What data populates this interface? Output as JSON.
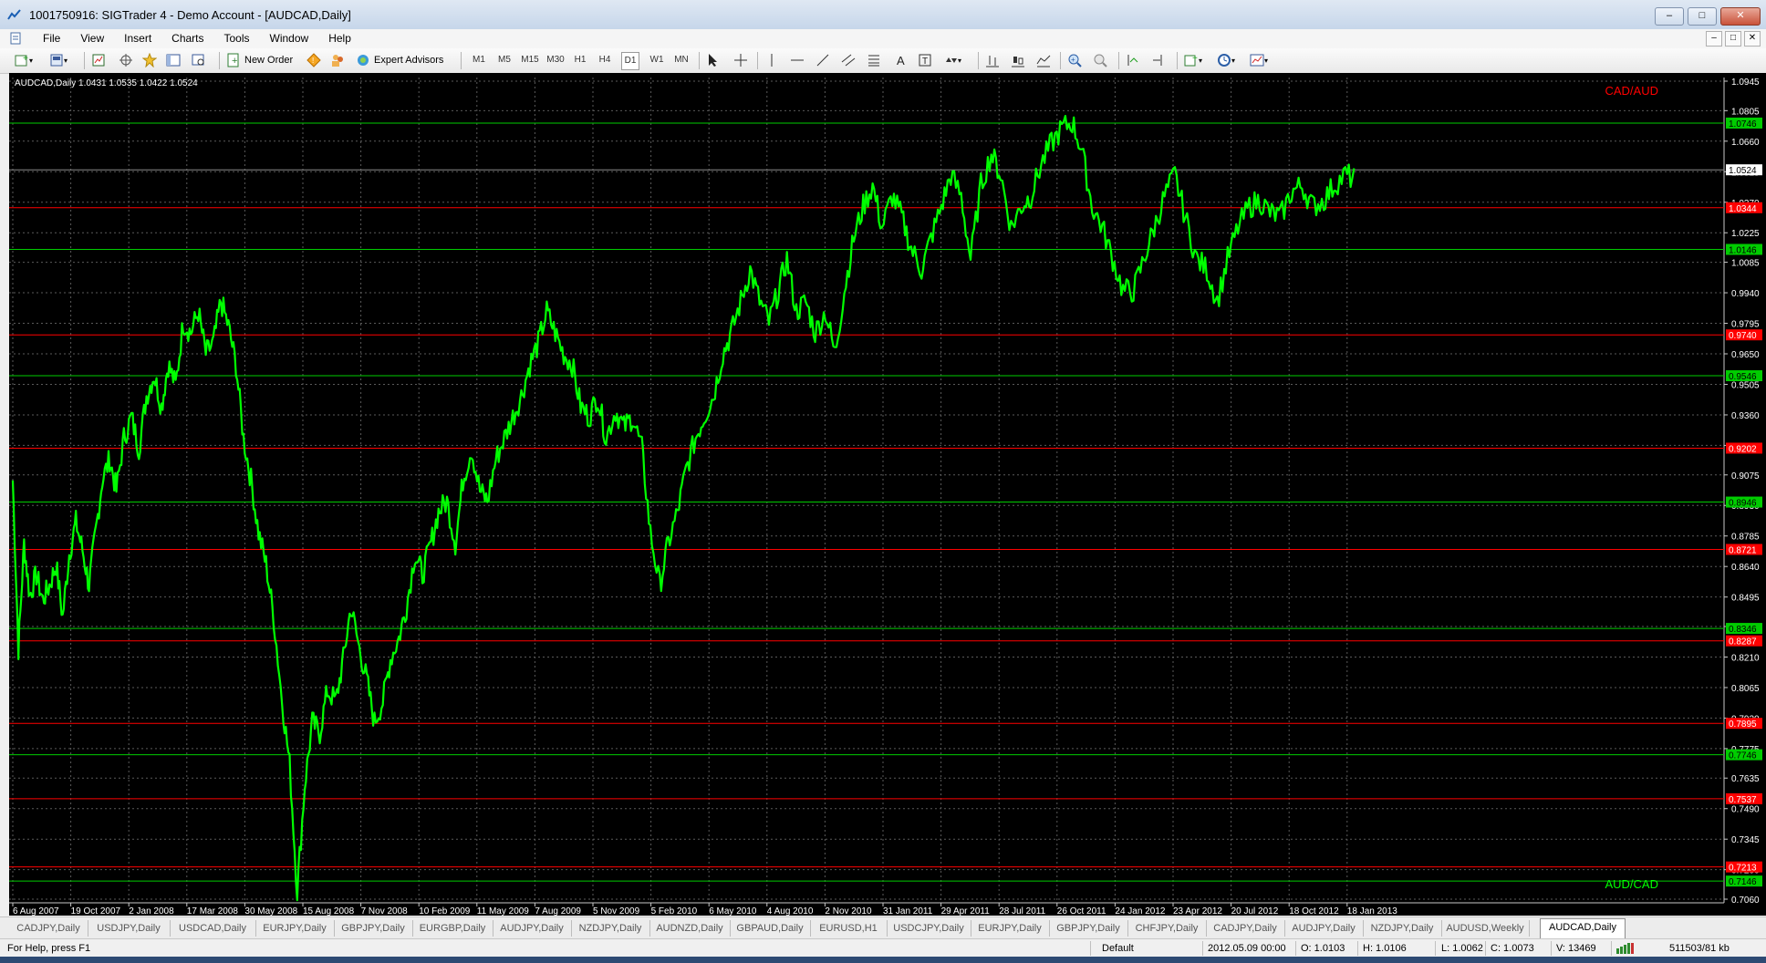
{
  "window": {
    "title": "1001750916: SIGTrader 4 - Demo Account - [AUDCAD,Daily]"
  },
  "menu": [
    "File",
    "View",
    "Insert",
    "Charts",
    "Tools",
    "Window",
    "Help"
  ],
  "toolbar": {
    "new_order": "New Order",
    "expert_advisors": "Expert Advisors",
    "timeframes": [
      "M1",
      "M5",
      "M15",
      "M30",
      "H1",
      "H4",
      "D1",
      "W1",
      "MN"
    ],
    "active_timeframe": "D1"
  },
  "chart": {
    "info": "AUDCAD,Daily  1.0431 1.0535 1.0422 1.0524",
    "label_top": "CAD/AUD",
    "label_bottom": "AUD/CAD",
    "colors": {
      "background": "#000000",
      "price": "#00ff00",
      "grid": "#5a5a5a",
      "support": "#00cc00",
      "resistance": "#ff0000",
      "current": "#8a8a8a",
      "label_red": "#ff0000",
      "label_green": "#00ff00"
    }
  },
  "chart_data": {
    "type": "line",
    "symbol": "AUDCAD",
    "timeframe": "Daily",
    "ylim": [
      0.706,
      1.0945
    ],
    "y_ticks": [
      "1.0945",
      "1.0805",
      "1.0660",
      "1.0515",
      "1.0370",
      "1.0225",
      "1.0085",
      "0.9940",
      "0.9795",
      "0.9650",
      "0.9505",
      "0.9360",
      "0.9215",
      "0.9075",
      "0.8930",
      "0.8785",
      "0.8640",
      "0.8495",
      "0.8355",
      "0.8210",
      "0.8065",
      "0.7920",
      "0.7775",
      "0.7635",
      "0.7490",
      "0.7345",
      "0.7200",
      "0.7060"
    ],
    "x_labels": [
      "6 Aug 2007",
      "19 Oct 2007",
      "2 Jan 2008",
      "17 Mar 2008",
      "30 May 2008",
      "15 Aug 2008",
      "7 Nov 2008",
      "10 Feb 2009",
      "11 May 2009",
      "7 Aug 2009",
      "5 Nov 2009",
      "5 Feb 2010",
      "6 May 2010",
      "4 Aug 2010",
      "2 Nov 2010",
      "31 Jan 2011",
      "29 Apr 2011",
      "28 Jul 2011",
      "26 Oct 2011",
      "24 Jan 2012",
      "23 Apr 2012",
      "20 Jul 2012",
      "18 Oct 2012",
      "18 Jan 2013"
    ],
    "current_price": 1.0524,
    "current_label": "1.0524",
    "levels": [
      {
        "price": 1.0746,
        "label": "1.0746",
        "kind": "support"
      },
      {
        "price": 1.0344,
        "label": "1.0344",
        "kind": "resistance"
      },
      {
        "price": 1.0146,
        "label": "1.0146",
        "kind": "support"
      },
      {
        "price": 0.974,
        "label": "0.9740",
        "kind": "resistance"
      },
      {
        "price": 0.9546,
        "label": "0.9546",
        "kind": "support"
      },
      {
        "price": 0.9202,
        "label": "0.9202",
        "kind": "resistance"
      },
      {
        "price": 0.8946,
        "label": "0.8946",
        "kind": "support"
      },
      {
        "price": 0.8721,
        "label": "0.8721",
        "kind": "resistance"
      },
      {
        "price": 0.8346,
        "label": "0.8346",
        "kind": "support"
      },
      {
        "price": 0.8287,
        "label": "0.8287",
        "kind": "resistance"
      },
      {
        "price": 0.7895,
        "label": "0.7895",
        "kind": "resistance"
      },
      {
        "price": 0.7746,
        "label": "0.7746",
        "kind": "support"
      },
      {
        "price": 0.7537,
        "label": "0.7537",
        "kind": "resistance"
      },
      {
        "price": 0.7213,
        "label": "0.7213",
        "kind": "resistance"
      },
      {
        "price": 0.7146,
        "label": "0.7146",
        "kind": "support"
      }
    ],
    "series_x": [
      0,
      0.6,
      1.2,
      1.8,
      2.5,
      3.2,
      3.9,
      4.6,
      5.3,
      6.0,
      6.7,
      7.4,
      8.1,
      8.8,
      9.5,
      10.3,
      11.0,
      11.8,
      12.6,
      13.4,
      14.2,
      15.0,
      15.8,
      16.5,
      17.3,
      18.1,
      18.9,
      19.7,
      20.5,
      21.3,
      22.1,
      22.9,
      23.7,
      24.5,
      25.3,
      26.1,
      26.9,
      27.7,
      28.6,
      29.4,
      30.2,
      31.0,
      31.8,
      32.6,
      33.4,
      34.3,
      35.1,
      35.9,
      36.8,
      37.6,
      38.4,
      39.3,
      40.1,
      41.0,
      41.8,
      42.7,
      43.5,
      44.4,
      45.2,
      46.1,
      47.0,
      47.8,
      48.7,
      49.6,
      50.4,
      51.3,
      52.2,
      53.1,
      54.0,
      54.9,
      55.8,
      56.7,
      57.6,
      58.5,
      59.4,
      60.3,
      61.2,
      62.1,
      63.0,
      64.0,
      64.9,
      65.8,
      66.8,
      67.7,
      68.7,
      69.6,
      70.6,
      71.5,
      72.5,
      73.4,
      74.4,
      75.4,
      76.3,
      77.3,
      78.3,
      79.3,
      80.3,
      81.3,
      82.2,
      83.2,
      84.2,
      85.2,
      86.3,
      87.3,
      88.3,
      89.3,
      90.3,
      91.3,
      92.3,
      93.4,
      94.4,
      95.4,
      96.5,
      97.5,
      98.6,
      99.6,
      100.7,
      101.7,
      102.8,
      103.9,
      104.9,
      106.0,
      107.1,
      108.1,
      109.2,
      110.3,
      111.4,
      112.5,
      113.5,
      114.6,
      115.7,
      116.8,
      117.9,
      119.0,
      120.1,
      121.2,
      122.3,
      123.4,
      124.5,
      125.7,
      126.8,
      127.9,
      129.0,
      130.1,
      131.3,
      132.4,
      133.5,
      134.6,
      135.8,
      136.9,
      138.0,
      139.2,
      140.3,
      141.5,
      142.6,
      143.8,
      144.9
    ],
    "series_y": [
      0.905,
      0.825,
      0.875,
      0.85,
      0.86,
      0.848,
      0.855,
      0.865,
      0.84,
      0.87,
      0.885,
      0.872,
      0.855,
      0.88,
      0.905,
      0.915,
      0.9,
      0.925,
      0.935,
      0.92,
      0.945,
      0.955,
      0.94,
      0.96,
      0.95,
      0.98,
      0.975,
      0.985,
      0.965,
      0.97,
      0.99,
      0.978,
      0.96,
      0.925,
      0.905,
      0.88,
      0.865,
      0.84,
      0.8,
      0.77,
      0.71,
      0.76,
      0.79,
      0.785,
      0.805,
      0.8,
      0.82,
      0.845,
      0.825,
      0.81,
      0.79,
      0.8,
      0.82,
      0.83,
      0.845,
      0.87,
      0.86,
      0.875,
      0.89,
      0.895,
      0.875,
      0.905,
      0.92,
      0.9,
      0.895,
      0.915,
      0.925,
      0.935,
      0.945,
      0.96,
      0.97,
      0.985,
      0.975,
      0.965,
      0.96,
      0.94,
      0.935,
      0.945,
      0.925,
      0.938,
      0.93,
      0.935,
      0.92,
      0.88,
      0.855,
      0.875,
      0.89,
      0.91,
      0.925,
      0.935,
      0.945,
      0.965,
      0.975,
      0.99,
      1.005,
      0.99,
      0.98,
      0.995,
      1.01,
      0.985,
      0.99,
      0.975,
      0.985,
      0.965,
      0.995,
      1.02,
      1.035,
      1.045,
      1.025,
      1.04,
      1.03,
      1.015,
      1.005,
      1.02,
      1.035,
      1.05,
      1.04,
      1.01,
      1.045,
      1.06,
      1.05,
      1.025,
      1.035,
      1.04,
      1.055,
      1.065,
      1.072,
      1.075,
      1.062,
      1.035,
      1.025,
      1.01,
      0.995,
      0.995,
      1.01,
      1.025,
      1.04,
      1.05,
      1.03,
      1.01,
      1.005,
      0.99,
      1.01,
      1.025,
      1.035,
      1.038,
      1.032,
      1.03,
      1.042,
      1.045,
      1.035,
      1.038,
      1.045,
      1.05,
      1.048
    ]
  },
  "tabs": [
    "CADJPY,Daily",
    "USDJPY,Daily",
    "USDCAD,Daily",
    "EURJPY,Daily",
    "GBPJPY,Daily",
    "EURGBP,Daily",
    "AUDJPY,Daily",
    "NZDJPY,Daily",
    "AUDNZD,Daily",
    "GBPAUD,Daily",
    "EURUSD,H1",
    "USDCJPY,Daily",
    "EURJPY,Daily",
    "GBPJPY,Daily",
    "CHFJPY,Daily",
    "CADJPY,Daily",
    "AUDJPY,Daily",
    "NZDJPY,Daily",
    "AUDUSD,Weekly",
    "AUDCAD,Daily"
  ],
  "active_tab": "AUDCAD,Daily",
  "status": {
    "help": "For Help, press F1",
    "profile": "Default",
    "datetime": "2012.05.09 00:00",
    "open": "O: 1.0103",
    "high": "H: 1.0106",
    "low": "L: 1.0062",
    "close": "C: 1.0073",
    "volume": "V: 13469",
    "traffic": "511503/81 kb"
  }
}
